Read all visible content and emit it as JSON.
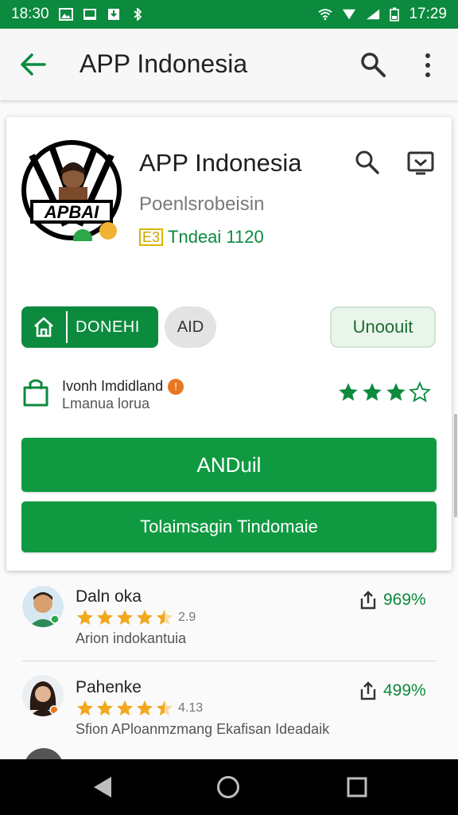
{
  "status_bar": {
    "time_left": "18:30",
    "time_right": "17:29"
  },
  "toolbar": {
    "title": "APP Indonesia"
  },
  "app": {
    "name": "APP Indonesia",
    "developer": "Poenlsrobeisin",
    "meta_badge": "E3",
    "meta_text": "Tndeai 1120",
    "logo_text": "APBAI"
  },
  "actions": {
    "install_home_label": "DONEHI",
    "aid_label": "AID",
    "unoout_label": "Unoouit"
  },
  "rating": {
    "title": "Ivonh Imdidland",
    "subtitle": "Lmanua loruа",
    "badge": "!",
    "stars_filled": 3,
    "stars_total": 4
  },
  "buttons": {
    "primary": "ANDuil",
    "secondary": "Tolaimsagin Tindomaie"
  },
  "reviews": [
    {
      "name": "Daln oka",
      "score": "2.9",
      "text": "Arion indokantuia",
      "share_value": "969%",
      "stars": 4.5
    },
    {
      "name": "Pahenke",
      "score": "4.13",
      "text": "Sfion APloanmzmang Ekafisan Ideadaik",
      "share_value": "499%",
      "stars": 4.5
    }
  ],
  "colors": {
    "green": "#0c8a3e",
    "button_green": "#0f9a41",
    "star_gold": "#f2a81d"
  }
}
